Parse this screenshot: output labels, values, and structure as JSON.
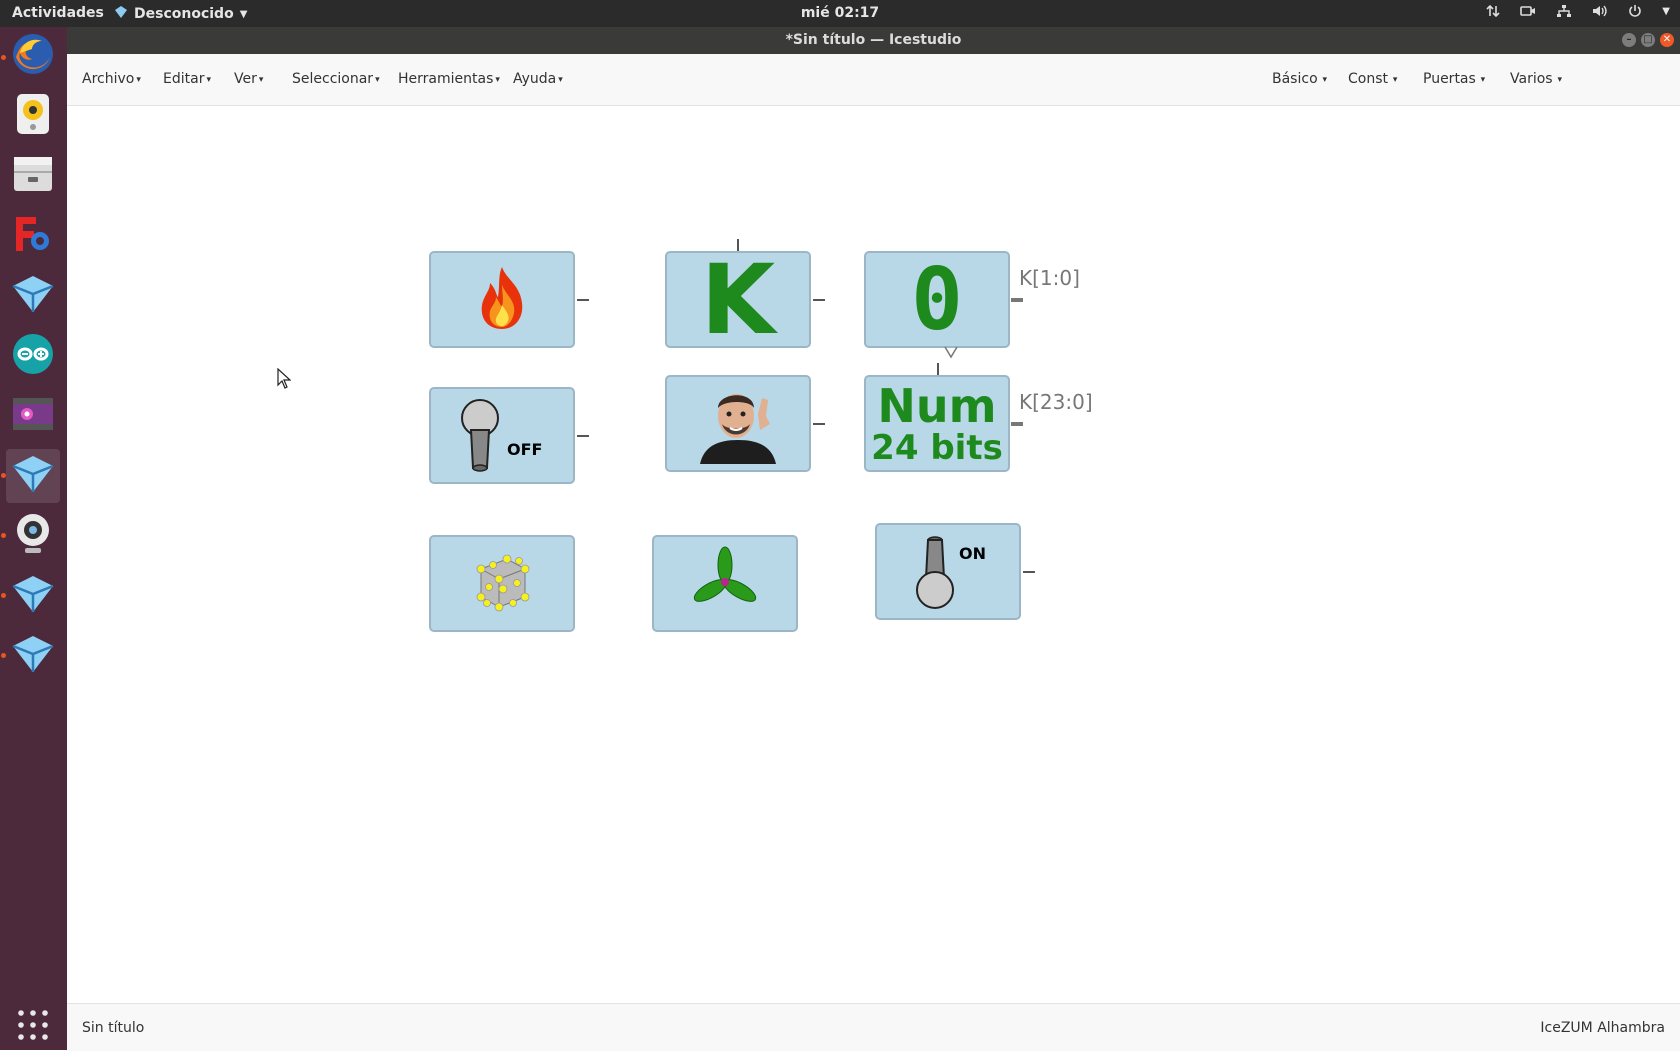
{
  "topbar": {
    "activities": "Actividades",
    "app_name": "Desconocido",
    "clock": "mié 02:17"
  },
  "window": {
    "title": "*Sin título — Icestudio"
  },
  "menubar": {
    "left": [
      "Archivo",
      "Editar",
      "Ver",
      "Seleccionar",
      "Herramientas",
      "Ayuda"
    ],
    "right": [
      "Básico",
      "Const",
      "Puertas",
      "Varios"
    ]
  },
  "canvas": {
    "blocks": [
      {
        "icon": "fire-icon"
      },
      {
        "icon": "letter-k-icon",
        "text": "K"
      },
      {
        "icon": "zero-icon",
        "text": "0"
      },
      {
        "icon": "switch-off-icon",
        "text": "OFF"
      },
      {
        "icon": "person-photo-icon"
      },
      {
        "icon": "num-icon",
        "line1": "Num",
        "line2": "24 bits"
      },
      {
        "icon": "cube-atoms-icon"
      },
      {
        "icon": "propeller-icon"
      },
      {
        "icon": "switch-on-icon",
        "text": "ON"
      }
    ],
    "port_labels": {
      "k_1_0": "K[1:0]",
      "k_23_0": "K[23:0]"
    }
  },
  "statusbar": {
    "left": "Sin título",
    "right": "IceZUM Alhambra"
  },
  "colors": {
    "block_fill": "#b8d8e8",
    "block_border": "#9cb6c6",
    "green_text": "#1e8a1e",
    "launcher_bg": "#4c2a3c",
    "topbar_bg": "#2b2b2b"
  }
}
